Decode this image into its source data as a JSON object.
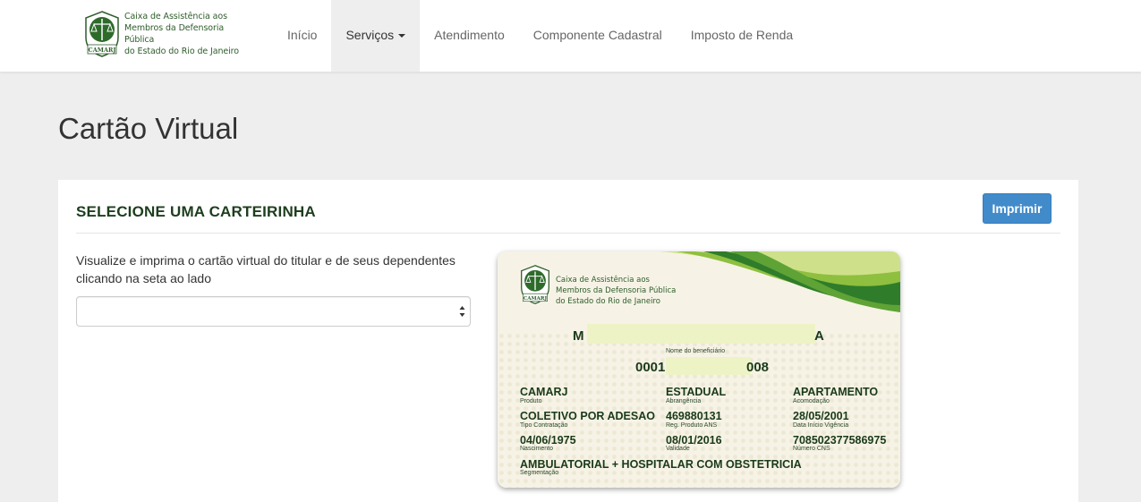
{
  "brand": {
    "line1": "Caixa de Assistência aos",
    "line2": "Membros da Defensoria Pública",
    "line3": "do Estado do Rio de Janeiro",
    "logo_text": "CAMARJ"
  },
  "nav": {
    "items": [
      {
        "label": "Início"
      },
      {
        "label": "Serviços"
      },
      {
        "label": "Atendimento"
      },
      {
        "label": "Componente Cadastral"
      },
      {
        "label": "Imposto de Renda"
      }
    ]
  },
  "page": {
    "title": "Cartão Virtual"
  },
  "panel": {
    "title": "SELECIONE UMA CARTEIRINHA",
    "print_label": "Imprimir",
    "instructions": "Visualize e imprima o cartão virtual do titular e de seus dependentes clicando na seta ao lado",
    "select_value": ""
  },
  "card": {
    "name_start": "M",
    "name_end": "A",
    "name_label": "Nome do beneficiário",
    "number_start": "0001",
    "number_end": "008",
    "fields": {
      "produto": {
        "value": "CAMARJ",
        "label": "Produto"
      },
      "abrangencia": {
        "value": "ESTADUAL",
        "label": "Abrangência"
      },
      "acomodacao": {
        "value": "APARTAMENTO",
        "label": "Acomodação"
      },
      "tipo": {
        "value": "COLETIVO POR ADESAO",
        "label": "Tipo Contratação"
      },
      "reg": {
        "value": "469880131",
        "label": "Reg. Produto ANS"
      },
      "vigencia": {
        "value": "28/05/2001",
        "label": "Data Início Vigência"
      },
      "nascimento": {
        "value": "04/06/1975",
        "label": "Nascimento"
      },
      "validade": {
        "value": "08/01/2016",
        "label": "Validade"
      },
      "cns": {
        "value": "708502377586975",
        "label": "Número CNS"
      },
      "segmentacao": {
        "value": "AMBULATORIAL + HOSPITALAR COM OBSTETRICIA",
        "label": "Segmentação"
      }
    }
  },
  "colors": {
    "brand_green": "#2e5d2b",
    "button_blue": "#428bca",
    "card_bg": "#f5f2e4"
  }
}
